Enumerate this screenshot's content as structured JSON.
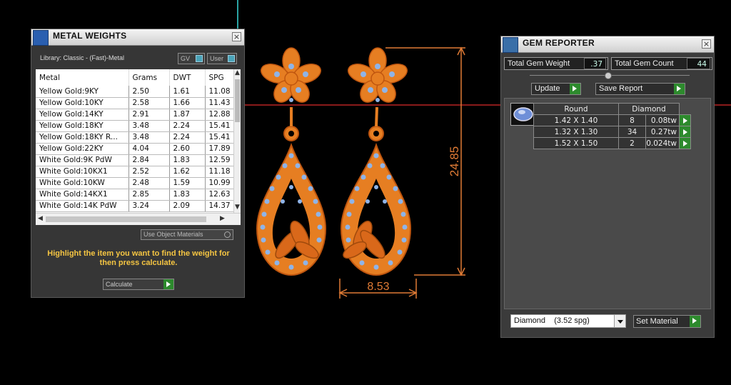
{
  "metal_panel": {
    "title": "METAL WEIGHTS",
    "library_label": "Library: Classic - (Fast)-Metal",
    "toggle_gv": "GV",
    "toggle_user": "User",
    "columns": [
      "Metal",
      "Grams",
      "DWT",
      "SPG"
    ],
    "rows": [
      [
        "Yellow Gold:9KY",
        "2.50",
        "1.61",
        "11.08"
      ],
      [
        "Yellow Gold:10KY",
        "2.58",
        "1.66",
        "11.43"
      ],
      [
        "Yellow Gold:14KY",
        "2.91",
        "1.87",
        "12.88"
      ],
      [
        "Yellow Gold:18KY",
        "3.48",
        "2.24",
        "15.41"
      ],
      [
        "Yellow Gold:18KY R...",
        "3.48",
        "2.24",
        "15.41"
      ],
      [
        "Yellow Gold:22KY",
        "4.04",
        "2.60",
        "17.89"
      ],
      [
        "White Gold:9K PdW",
        "2.84",
        "1.83",
        "12.59"
      ],
      [
        "White Gold:10KX1",
        "2.52",
        "1.62",
        "11.18"
      ],
      [
        "White Gold:10KW",
        "2.48",
        "1.59",
        "10.99"
      ],
      [
        "White Gold:14KX1",
        "2.85",
        "1.83",
        "12.63"
      ],
      [
        "White Gold:14K PdW",
        "3.24",
        "2.09",
        "14.37"
      ]
    ],
    "use_object_materials": "Use Object Materials",
    "hint": "Highlight the item you want to find the weight for then press calculate.",
    "calculate_label": "Calculate"
  },
  "gem_panel": {
    "title": "GEM REPORTER",
    "total_weight_label": "Total Gem Weight",
    "total_weight_value": ".37",
    "total_count_label": "Total Gem Count",
    "total_count_value": "44",
    "update_label": "Update",
    "save_report_label": "Save Report",
    "table_headers": [
      "Round",
      "Diamond"
    ],
    "rows": [
      [
        "1.42 X 1.40",
        "8",
        "0.08tw"
      ],
      [
        "1.32 X 1.30",
        "34",
        "0.27tw"
      ],
      [
        "1.52 X 1.50",
        "2",
        "0.024tw"
      ]
    ],
    "material_select": "Diamond    (3.52 spg)",
    "set_material_label": "Set Material"
  },
  "viewport": {
    "dim_height": "24.85",
    "dim_width": "8.53",
    "metal_color": "#e67e22",
    "gem_color": "#8fb4e8",
    "dimension_color": "#e07b35",
    "axis_color": "#8a1a1a"
  }
}
